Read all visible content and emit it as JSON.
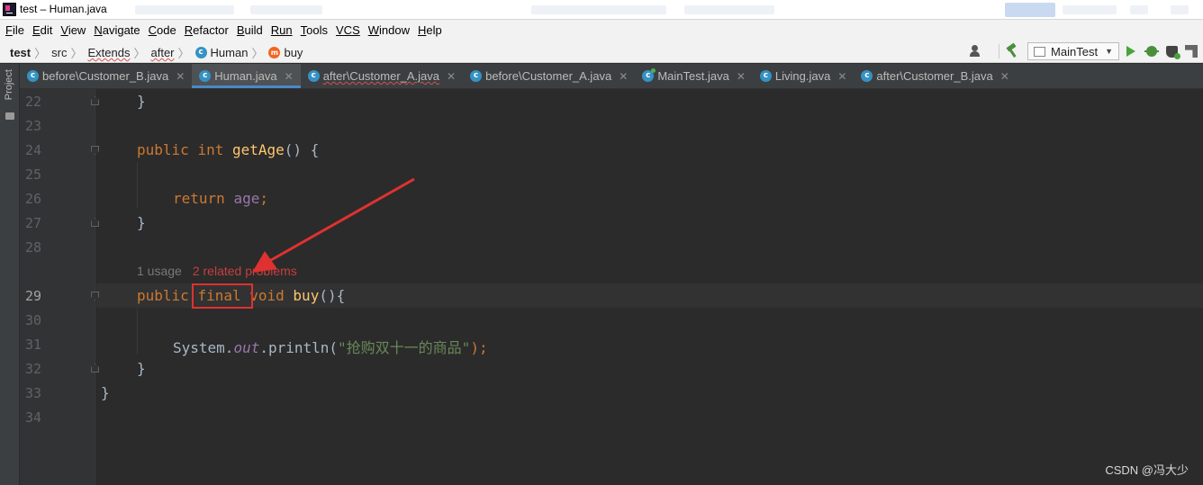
{
  "window": {
    "title": "test – Human.java"
  },
  "menu": [
    {
      "label": "File",
      "mn": "F",
      "rest": "ile"
    },
    {
      "label": "Edit",
      "mn": "E",
      "rest": "dit"
    },
    {
      "label": "View",
      "mn": "V",
      "rest": "iew"
    },
    {
      "label": "Navigate",
      "mn": "N",
      "rest": "avigate"
    },
    {
      "label": "Code",
      "mn": "C",
      "rest": "ode"
    },
    {
      "label": "Refactor",
      "mn": "R",
      "rest": "efactor"
    },
    {
      "label": "Build",
      "mn": "B",
      "rest": "uild"
    },
    {
      "label": "Run",
      "mn": "",
      "rest": "Run"
    },
    {
      "label": "Tools",
      "mn": "T",
      "rest": "ools"
    },
    {
      "label": "VCS",
      "mn": "",
      "rest": "VCS"
    },
    {
      "label": "Window",
      "mn": "W",
      "rest": "indow"
    },
    {
      "label": "Help",
      "mn": "H",
      "rest": "elp"
    }
  ],
  "breadcrumb": {
    "project": "test",
    "src": "src",
    "pkg1": "Extends",
    "pkg2": "after",
    "cls": "Human",
    "method": "buy"
  },
  "toolbar": {
    "run_config": "MainTest"
  },
  "toolwindow": {
    "project_label": "Project"
  },
  "tabs": [
    {
      "label": "before\\Customer_B.java",
      "active": false,
      "error": false
    },
    {
      "label": "Human.java",
      "active": true,
      "error": false
    },
    {
      "label": "after\\Customer_A.java",
      "active": false,
      "error": true
    },
    {
      "label": "before\\Customer_A.java",
      "active": false,
      "error": false
    },
    {
      "label": "MainTest.java",
      "active": false,
      "error": false
    },
    {
      "label": "Living.java",
      "active": false,
      "error": false
    },
    {
      "label": "after\\Customer_B.java",
      "active": false,
      "error": false
    }
  ],
  "editor": {
    "line_numbers": [
      "22",
      "23",
      "24",
      "25",
      "26",
      "27",
      "28",
      "29",
      "30",
      "31",
      "32",
      "33",
      "34"
    ],
    "current_line": "29",
    "code": {
      "l22_brace": "}",
      "l24_public": "public",
      "l24_int": "int",
      "l24_name": "getAge",
      "l24_rest": "() {",
      "l26_return": "return",
      "l26_field": "age",
      "l26_semi": ";",
      "l27_brace": "}",
      "l29_public": "public",
      "l29_final": "final",
      "l29_void": "void",
      "l29_name": "buy",
      "l29_rest": "(){",
      "l31_system": "System.",
      "l31_out": "out",
      "l31_println": ".println(",
      "l31_string": "\"抢购双十一的商品\"",
      "l31_end": ");",
      "l32_brace": "}",
      "l33_brace": "}"
    },
    "inlay_hint": {
      "usage": "1 usage",
      "problems": "2 related problems"
    }
  },
  "watermark": "CSDN @冯大少",
  "colors": {
    "keyword": "#cc7832",
    "method": "#ffc66d",
    "field": "#9876aa",
    "string": "#6a8759",
    "annotation_box": "#e03131",
    "arrow": "#e03131"
  }
}
